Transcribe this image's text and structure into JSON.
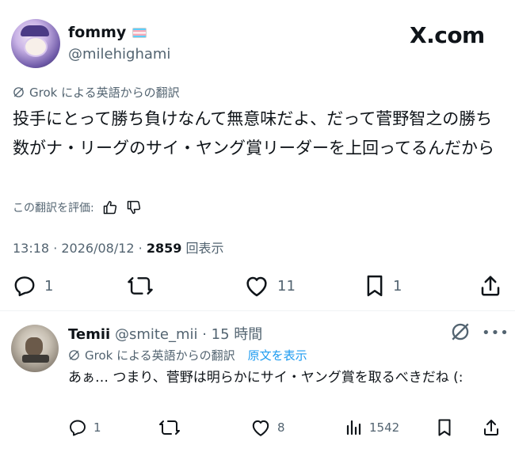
{
  "main_post": {
    "display_name": "fommy",
    "handle": "@milehighami",
    "flag_icon": "trans-flag-icon",
    "brand": "X.com",
    "translation_label": "Grok による英語からの翻訳",
    "text": "投手にとって勝ち負けなんて無意味だよ、だって菅野智之の勝ち数がナ・リーグのサイ・ヤング賞リーダーを上回ってるんだから",
    "rate_label": "この翻訳を評価:",
    "timestamp": "13:18 · 2026/08/12 · ",
    "views_count": "2859",
    "views_label": " 回表示",
    "actions": {
      "reply_count": "1",
      "retweet_count": "",
      "like_count": "11",
      "bookmark_count": "1"
    }
  },
  "reply_post": {
    "display_name": "Temii",
    "handle_and_time": "@smite_mii · 15 時間",
    "translation_label": "Grok による英語からの翻訳",
    "show_original": "原文を表示",
    "text": "あぁ… つまり、菅野は明らかにサイ・ヤング賞を取るべきだね (:",
    "actions": {
      "reply_count": "1",
      "retweet_count": "",
      "like_count": "8",
      "views_count": "1542"
    }
  },
  "colors": {
    "text_primary": "#0f1419",
    "text_secondary": "#536471",
    "link": "#1d9bf0"
  }
}
